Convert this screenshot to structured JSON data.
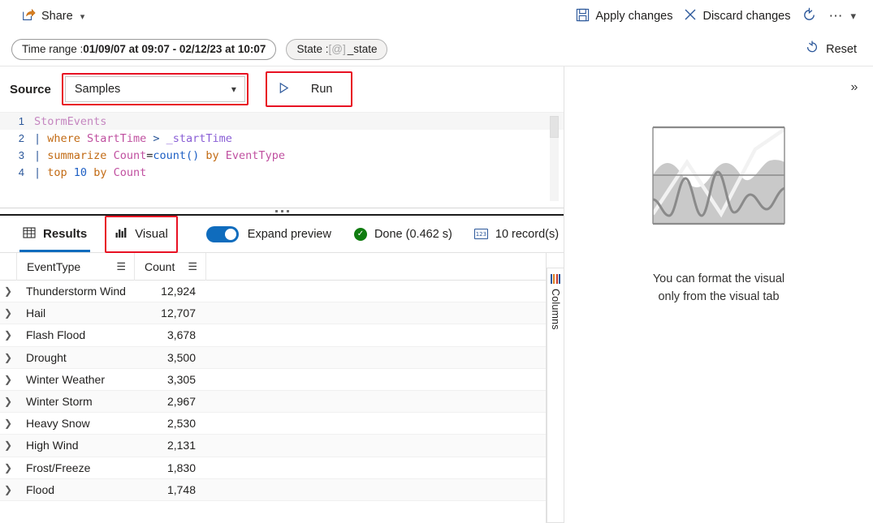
{
  "commandbar": {
    "share_label": "Share",
    "share_icon": "share-icon",
    "share_chevron": "chevron-down-icon",
    "apply_label": "Apply changes",
    "apply_icon": "save-icon",
    "discard_label": "Discard changes",
    "discard_icon": "close-icon",
    "refresh_icon": "refresh-icon",
    "overflow_label": "⋯",
    "overflow_chevron": "chevron-down-icon"
  },
  "filterbar": {
    "time_range_prefix": "Time range : ",
    "time_range_value": "01/09/07 at 09:07 - 02/12/23 at 10:07",
    "state_prefix": "State : ",
    "state_token": "[@]",
    "state_value": "_state",
    "reset_label": "Reset",
    "reset_icon": "undo-icon"
  },
  "source": {
    "label": "Source",
    "selected": "Samples",
    "chevron": "chevron-down-icon",
    "run_label": "Run",
    "run_icon": "play-icon",
    "highlight_color": "#e81123"
  },
  "editor": {
    "lines": [
      {
        "number": "1",
        "text": "StormEvents"
      },
      {
        "number": "2",
        "text": "| where StartTime > _startTime"
      },
      {
        "number": "3",
        "text": "| summarize Count=count() by EventType"
      },
      {
        "number": "4",
        "text": "| top 10 by Count"
      }
    ]
  },
  "results": {
    "tab_results": "Results",
    "tab_results_icon": "table-icon",
    "tab_visual": "Visual",
    "tab_visual_icon": "chart-icon",
    "expand_preview_label": "Expand preview",
    "expand_preview_on": true,
    "status_text": "Done (0.462 s)",
    "status_icon": "check-circle-icon",
    "record_count_text": "10 record(s)",
    "record_count_icon": "number-icon",
    "columns_rail_label": "Columns",
    "columns_rail_icon": "columns-icon"
  },
  "table": {
    "columns": [
      "EventType",
      "Count"
    ],
    "header_menu_icon": "menu-icon",
    "row_expand_icon": "chevron-right-icon",
    "rows": [
      {
        "event_type": "Thunderstorm Wind",
        "count": "12,924"
      },
      {
        "event_type": "Hail",
        "count": "12,707"
      },
      {
        "event_type": "Flash Flood",
        "count": "3,678"
      },
      {
        "event_type": "Drought",
        "count": "3,500"
      },
      {
        "event_type": "Winter Weather",
        "count": "3,305"
      },
      {
        "event_type": "Winter Storm",
        "count": "2,967"
      },
      {
        "event_type": "Heavy Snow",
        "count": "2,530"
      },
      {
        "event_type": "High Wind",
        "count": "2,131"
      },
      {
        "event_type": "Frost/Freeze",
        "count": "1,830"
      },
      {
        "event_type": "Flood",
        "count": "1,748"
      }
    ]
  },
  "visual_panel": {
    "expand_icon": "chevron-double-right-icon",
    "placeholder_icon": "chart-placeholder-icon",
    "placeholder_line1": "You can format the visual",
    "placeholder_line2": "only from the visual tab"
  },
  "colors": {
    "accent": "#0f6cbd",
    "highlight": "#e81123",
    "success": "#107c10"
  }
}
